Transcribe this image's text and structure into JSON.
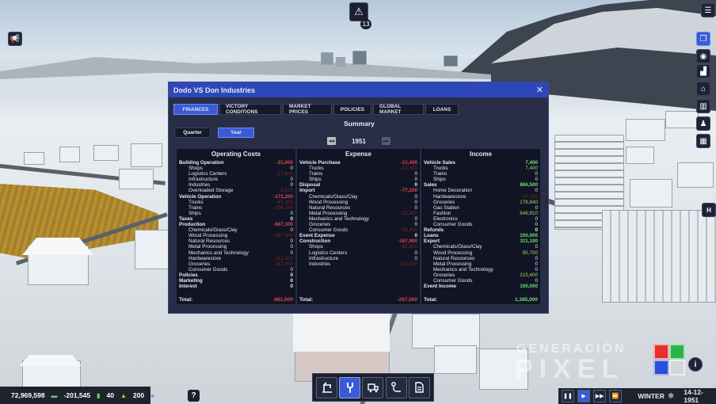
{
  "hud": {
    "alert_count": "13",
    "money": "72,969,598",
    "change": "-201,545",
    "level_a": "40",
    "level_b": "200",
    "help": "?",
    "season": "WINTER",
    "date": "14-12-1951"
  },
  "watermark": {
    "line1": "GENERACIÓN",
    "line2": "PIXEL"
  },
  "window": {
    "title": "Dodo VS Don Industries",
    "close": "✕",
    "tabs": [
      "FINANCES",
      "VICTORY CONDITIONS",
      "MARKET PRICES",
      "POLICIES",
      "GLOBAL MARKET",
      "LOANS"
    ],
    "periods": [
      "Quarter",
      "Year"
    ],
    "summary": "Summary",
    "year": "1951",
    "prev": "◂◂",
    "next": "▸▸"
  },
  "operating": {
    "title": "Operating Costs",
    "rows": [
      {
        "l": "Building Operation",
        "v": "-21,000",
        "b": true,
        "c": "neg"
      },
      {
        "l": "Shops",
        "v": "0",
        "c": "zero"
      },
      {
        "l": "Logistics Centers",
        "v": "-17,800",
        "c": "negd"
      },
      {
        "l": "Infrastructure",
        "v": "0",
        "c": "zero"
      },
      {
        "l": "Industries",
        "v": "0",
        "c": "zero"
      },
      {
        "l": "Overloaded Storage",
        "v": "-3,200",
        "c": "negd"
      },
      {
        "l": "Vehicle Operation",
        "v": "-171,200",
        "b": true,
        "c": "neg"
      },
      {
        "l": "Trucks",
        "v": "-67,100",
        "c": "negd"
      },
      {
        "l": "Trains",
        "v": "-104,200",
        "c": "negd"
      },
      {
        "l": "Ships",
        "v": "0",
        "c": "zero"
      },
      {
        "l": "Taxes",
        "v": "0",
        "b": true,
        "c": "zero"
      },
      {
        "l": "Production",
        "v": "-687,300",
        "b": true,
        "c": "neg"
      },
      {
        "l": "Chemicals/Glass/Clay",
        "v": "0",
        "c": "zero"
      },
      {
        "l": "Wood Processing",
        "v": "-187,300",
        "c": "negd"
      },
      {
        "l": "Natural Resources",
        "v": "0",
        "c": "zero"
      },
      {
        "l": "Metal Processing",
        "v": "0",
        "c": "zero"
      },
      {
        "l": "Mechanics and Technology",
        "v": "0",
        "c": "zero"
      },
      {
        "l": "Hardwarestore",
        "v": "-112,500",
        "c": "negd"
      },
      {
        "l": "Groceries",
        "v": "-387,300",
        "c": "negd"
      },
      {
        "l": "Consumer Goods",
        "v": "0",
        "c": "zero"
      },
      {
        "l": "Policies",
        "v": "0",
        "b": true,
        "c": "zero"
      },
      {
        "l": "Marketing",
        "v": "0",
        "b": true,
        "c": "zero"
      },
      {
        "l": "Interest",
        "v": "0",
        "b": true,
        "c": "zero"
      }
    ],
    "total_label": "Total:",
    "total": "-881,600"
  },
  "expense": {
    "title": "Expense",
    "rows": [
      {
        "l": "Vehicle Purchase",
        "v": "-12,400",
        "b": true,
        "c": "neg"
      },
      {
        "l": "Trucks",
        "v": "-12,400",
        "c": "negd"
      },
      {
        "l": "Trains",
        "v": "0",
        "c": "zero"
      },
      {
        "l": "Ships",
        "v": "0",
        "c": "zero"
      },
      {
        "l": "Disposal",
        "v": "0",
        "b": true,
        "c": "zero"
      },
      {
        "l": "Import",
        "v": "-77,200",
        "b": true,
        "c": "neg"
      },
      {
        "l": "Chemicals/Glass/Clay",
        "v": "0",
        "c": "zero"
      },
      {
        "l": "Wood Processing",
        "v": "0",
        "c": "zero"
      },
      {
        "l": "Natural Resources",
        "v": "0",
        "c": "zero"
      },
      {
        "l": "Metal Processing",
        "v": "-22,800",
        "c": "negd"
      },
      {
        "l": "Mechanics and Technology",
        "v": "0",
        "c": "zero"
      },
      {
        "l": "Groceries",
        "v": "0",
        "c": "zero"
      },
      {
        "l": "Consumer Goods",
        "v": "-54,400",
        "c": "negd"
      },
      {
        "l": "Event Expense",
        "v": "0",
        "b": true,
        "c": "zero"
      },
      {
        "l": "Construction",
        "v": "-167,900",
        "b": true,
        "c": "neg"
      },
      {
        "l": "Shops",
        "v": "-67,900",
        "c": "negd"
      },
      {
        "l": "Logistics Centers",
        "v": "0",
        "c": "zero"
      },
      {
        "l": "Infrastructure",
        "v": "0",
        "c": "zero"
      },
      {
        "l": "Industries",
        "v": "-100,000",
        "c": "negd"
      }
    ],
    "total_label": "Total:",
    "total": "-257,500"
  },
  "income": {
    "title": "Income",
    "rows": [
      {
        "l": "Vehicle Sales",
        "v": "7,400",
        "b": true,
        "c": "pos"
      },
      {
        "l": "Trucks",
        "v": "7,400",
        "c": "posd"
      },
      {
        "l": "Trains",
        "v": "0",
        "c": "zero"
      },
      {
        "l": "Ships",
        "v": "0",
        "c": "zero"
      },
      {
        "l": "Sales",
        "v": "866,500",
        "b": true,
        "c": "pos"
      },
      {
        "l": "Home Decoration",
        "v": "0",
        "c": "zero"
      },
      {
        "l": "Hardwarestore",
        "v": "-37,750",
        "c": "negd"
      },
      {
        "l": "Groceries",
        "v": "178,840",
        "c": "posd"
      },
      {
        "l": "Gas Station",
        "v": "0",
        "c": "zero"
      },
      {
        "l": "Fashion",
        "v": "649,910",
        "c": "posd"
      },
      {
        "l": "Electronics",
        "v": "0",
        "c": "zero"
      },
      {
        "l": "Consumer Goods",
        "v": "0",
        "c": "zero"
      },
      {
        "l": "Refunds",
        "v": "0",
        "b": true,
        "c": "zero"
      },
      {
        "l": "Loans",
        "v": "100,000",
        "b": true,
        "c": "pos"
      },
      {
        "l": "Export",
        "v": "311,100",
        "b": true,
        "c": "pos"
      },
      {
        "l": "Chemicals/Glass/Clay",
        "v": "0",
        "c": "zero"
      },
      {
        "l": "Wood Processing",
        "v": "95,700",
        "c": "posd"
      },
      {
        "l": "Natural Resources",
        "v": "0",
        "c": "zero"
      },
      {
        "l": "Metal Processing",
        "v": "0",
        "c": "zero"
      },
      {
        "l": "Mechanics and Technology",
        "v": "0",
        "c": "zero"
      },
      {
        "l": "Groceries",
        "v": "215,400",
        "c": "posd"
      },
      {
        "l": "Consumer Goods",
        "v": "0",
        "c": "zero"
      },
      {
        "l": "Event Income",
        "v": "100,000",
        "b": true,
        "c": "pos"
      }
    ],
    "total_label": "Total:",
    "total": "1,385,000"
  }
}
